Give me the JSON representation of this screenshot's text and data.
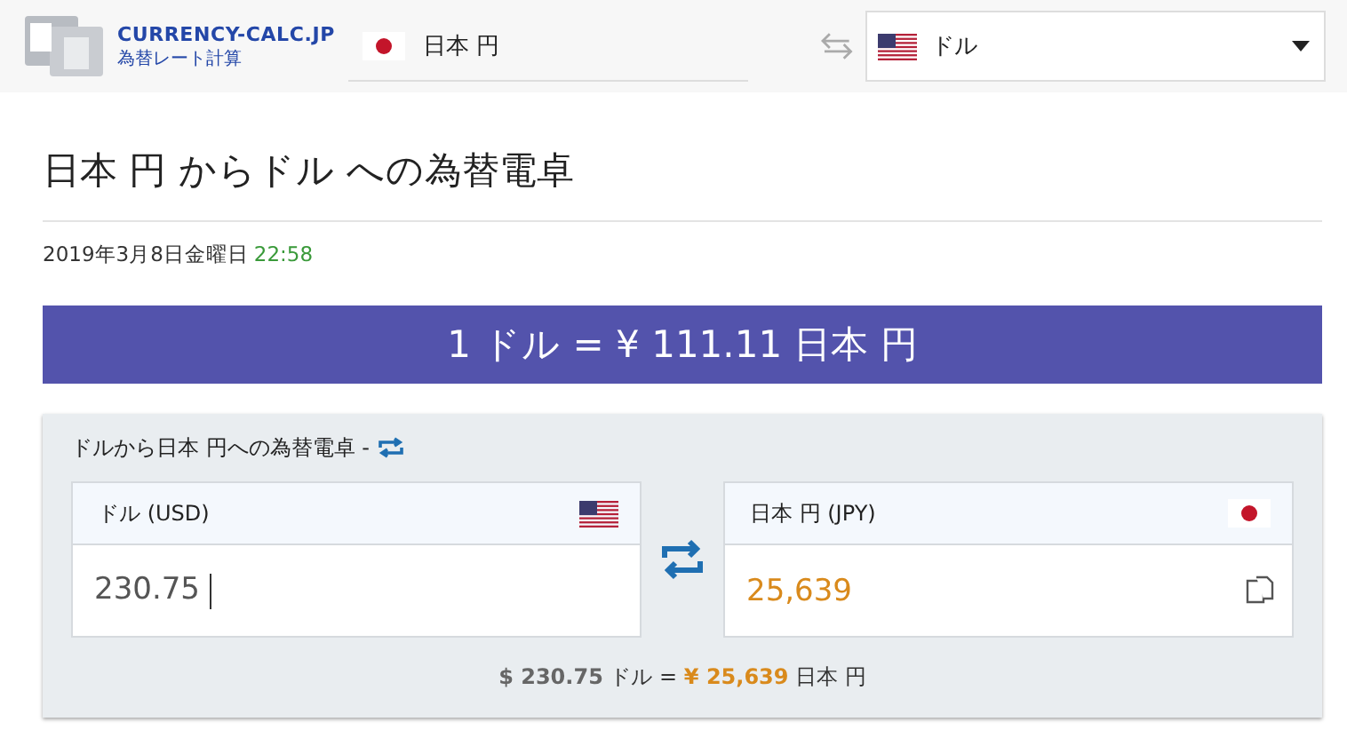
{
  "header": {
    "logo_title": "CURRENCY-CALC.JP",
    "logo_subtitle": "為替レート計算",
    "from_currency": "日本 円",
    "to_currency": "ドル"
  },
  "title": "日本 円 からドル への為替電卓",
  "date": "2019年3月8日金曜日",
  "time": "22:58",
  "rate_banner": "1 ドル = ¥ 111.11 日本 円",
  "calculator": {
    "title": "ドルから日本 円への為替電卓 -",
    "from": {
      "label": "ドル (USD)",
      "value": "230.75"
    },
    "to": {
      "label": "日本 円 (JPY)",
      "value": "25,639"
    },
    "summary": "**$ 230.75** ドル = **¥ 25,639** 日本 円"
  }
}
